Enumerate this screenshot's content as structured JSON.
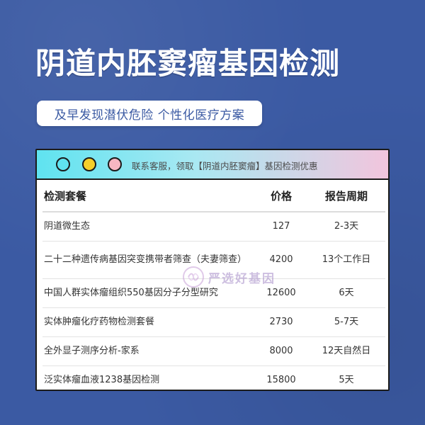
{
  "title": "阴道内胚窦瘤基因检测",
  "subtitle": "及早发现潜伏危险 个性化医疗方案",
  "card": {
    "header_text": "联系客服，领取【阴道内胚窦瘤】基因检测优惠",
    "dots": [
      "cyan",
      "yellow",
      "pink"
    ]
  },
  "table": {
    "headers": [
      "检测套餐",
      "价格",
      "报告周期"
    ],
    "rows": [
      [
        "阴道微生态",
        "127",
        "2-3天"
      ],
      [
        "二十二种遗传病基因突变携带者筛查（夫妻筛查）",
        "4200",
        "13个工作日"
      ],
      [
        "中国人群实体瘤组织550基因分子分型研究",
        "12600",
        "6天"
      ],
      [
        "实体肿瘤化疗药物检测套餐",
        "2730",
        "5-7天"
      ],
      [
        "全外显子测序分析-家系",
        "8000",
        "12天自然日"
      ],
      [
        "泛实体瘤血液1238基因检测",
        "15800",
        "5天"
      ]
    ]
  },
  "watermark": "严选好基因",
  "colors": {
    "background": "#3b5aa3",
    "header_gradient_start": "#5fe3f0",
    "header_gradient_end": "#f2c5dd",
    "dot_yellow": "#f6cf2a",
    "dot_pink": "#f7b6c2"
  }
}
